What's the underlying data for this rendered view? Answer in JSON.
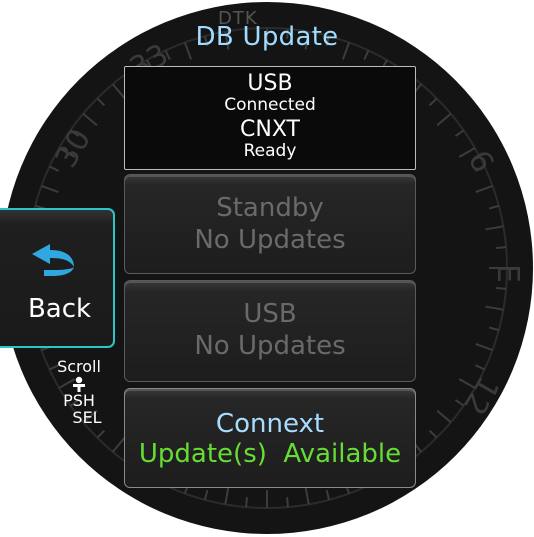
{
  "header": {
    "title": "DB Update",
    "dtk_label": "DTK"
  },
  "status": {
    "usb_label": "USB",
    "usb_state": "Connected",
    "cnxt_label": "CNXT",
    "cnxt_state": "Ready"
  },
  "buttons": [
    {
      "line1": "Standby",
      "line2": "No Updates",
      "state": "disabled"
    },
    {
      "line1": "USB",
      "line2": "No Updates",
      "state": "disabled"
    },
    {
      "line1": "Connext",
      "line2": "Update(s)  Available",
      "state": "active"
    }
  ],
  "back_button": {
    "label": "Back",
    "icon": "back-arrow-icon"
  },
  "knob_hint": {
    "scroll": "Scroll",
    "push": "PSH",
    "select": "SEL",
    "icon": "knob-icon"
  },
  "compass": {
    "labels": [
      "33",
      "30",
      "6",
      "E",
      "12"
    ]
  },
  "colors": {
    "title": "#9fdcff",
    "active_line1": "#a8dcff",
    "available": "#66dd33",
    "back_border": "#2dc5c5",
    "back_arrow": "#2fa8e0",
    "disabled_text": "#6a6a6a"
  }
}
